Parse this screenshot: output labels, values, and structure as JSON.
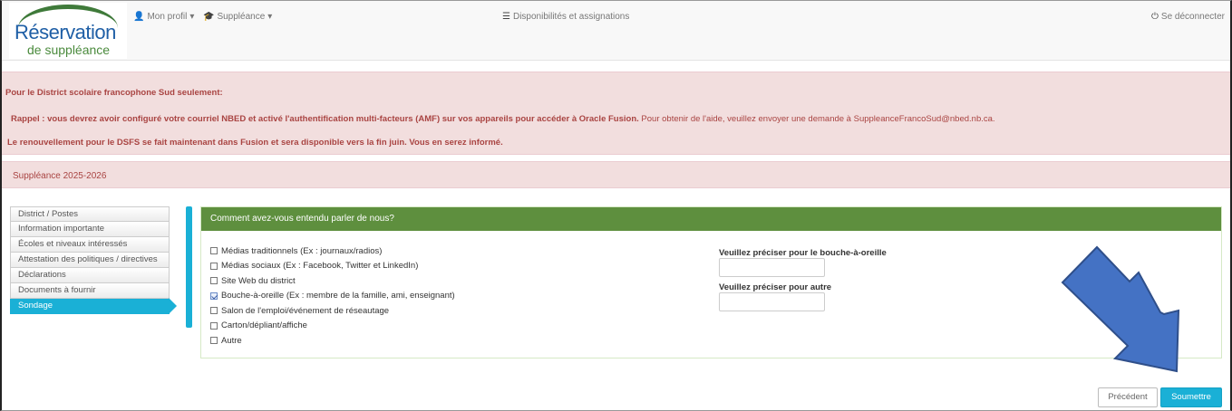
{
  "logo": {
    "line1": "Réservation",
    "line2": "de suppléance"
  },
  "nav": {
    "profile": "Mon profil",
    "substitution": "Suppléance",
    "availability": "Disponibilités et assignations",
    "logout": "Se déconnecter",
    "caret": "▾"
  },
  "alerts": {
    "line1": "Pour le District scolaire francophone Sud seulement:",
    "line2_bold": "Rappel : vous devrez avoir configuré votre courriel NBED et activé l'authentification multi-facteurs (AMF) sur vos appareils pour accéder à Oracle Fusion.",
    "line2_rest": " Pour obtenir de l'aide, veuillez envoyer une demande à SuppleanceFrancoSud@nbed.nb.ca.",
    "line3": "Le renouvellement pour le DSFS se fait maintenant dans Fusion et sera disponible vers la fin juin. Vous en serez informé.",
    "season": "Suppléance 2025-2026"
  },
  "sidebar": {
    "items": [
      {
        "label": "District / Postes"
      },
      {
        "label": "Information importante"
      },
      {
        "label": "Écoles et niveaux intéressés"
      },
      {
        "label": "Attestation des politiques / directives"
      },
      {
        "label": "Déclarations"
      },
      {
        "label": "Documents à fournir"
      },
      {
        "label": "Sondage"
      }
    ],
    "active_index": 6
  },
  "survey": {
    "title": "Comment avez-vous entendu parler de nous?",
    "options": [
      {
        "label": "Médias traditionnels (Ex : journaux/radios)",
        "checked": false
      },
      {
        "label": "Médias sociaux (Ex : Facebook, Twitter et LinkedIn)",
        "checked": false
      },
      {
        "label": "Site Web du district",
        "checked": false
      },
      {
        "label": "Bouche-à-oreille (Ex : membre de la famille, ami, enseignant)",
        "checked": true
      },
      {
        "label": "Salon de l'emploi/événement de réseautage",
        "checked": false
      },
      {
        "label": "Carton/dépliant/affiche",
        "checked": false
      },
      {
        "label": "Autre",
        "checked": false
      }
    ],
    "word_of_mouth_label": "Veuillez préciser pour le bouche-à-oreille",
    "word_of_mouth_value": "",
    "other_label": "Veuillez préciser pour autre",
    "other_value": ""
  },
  "buttons": {
    "previous": "Précédent",
    "submit": "Soumettre"
  },
  "colors": {
    "accent": "#1ab0d6",
    "panel_header": "#5e8f3e",
    "alert_bg": "#f2dede",
    "alert_text": "#a94442",
    "arrow": "#4472c4"
  }
}
